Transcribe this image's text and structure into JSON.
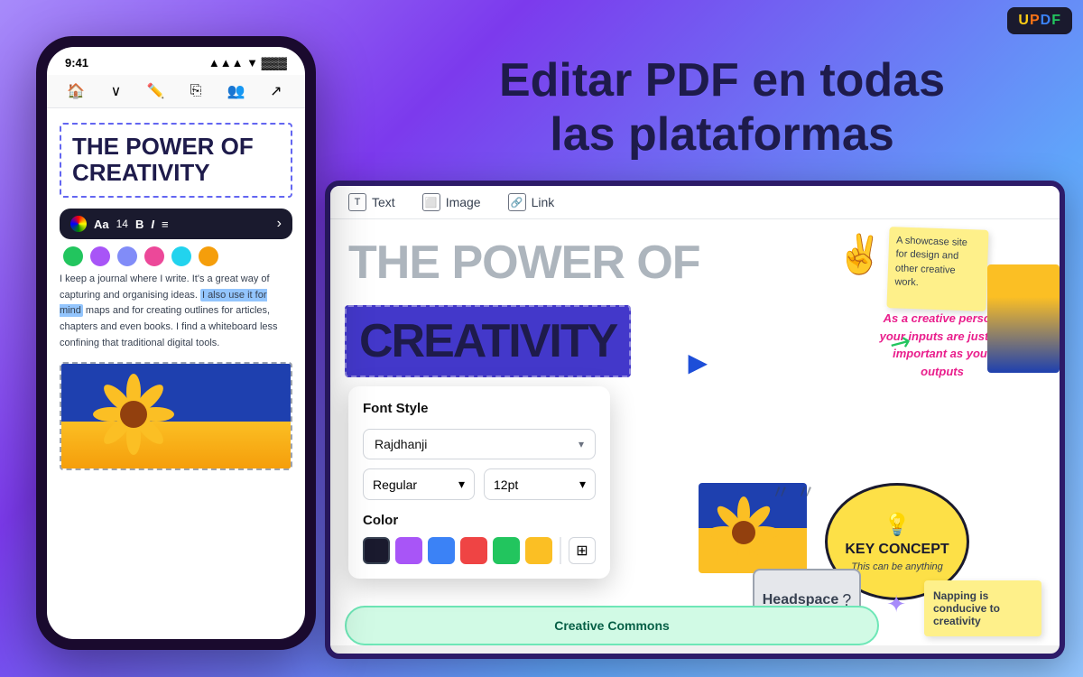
{
  "app": {
    "logo": "UPDF",
    "logo_colors": {
      "u": "#facc15",
      "p": "#f97316",
      "d": "#3b82f6",
      "f": "#22c55e"
    }
  },
  "hero": {
    "title_line1": "Editar PDF en todas",
    "title_line2": "las plataformas"
  },
  "phone": {
    "status_time": "9:41",
    "signal_icons": "▲▲▲ ▲ ▓▓▓",
    "title": "THE POWER OF CREATIVITY",
    "body_text": "I keep a journal where I write. It's a great way of capturing and organising ideas.",
    "highlight": "I also use it for mind",
    "body_text2": "maps and for creating outlines for articles, chapters and even books. I find a whiteboard less confining that traditional digital tools.",
    "text_toolbar": {
      "font_label": "Aa",
      "size": "14",
      "bold": "B",
      "italic": "I",
      "align": "≡"
    },
    "colors": [
      "#22c55e",
      "#a855f7",
      "#818cf8",
      "#ec4899",
      "#22d3ee",
      "#f59e0b"
    ]
  },
  "tablet": {
    "toolbar": {
      "items": [
        {
          "icon": "T",
          "label": "Text"
        },
        {
          "icon": "⬜",
          "label": "Image"
        },
        {
          "icon": "🔗",
          "label": "Link"
        }
      ]
    },
    "big_title_line1": "THE POWER OF",
    "big_title_line2": "CREATIVITY",
    "font_panel": {
      "title": "Font Style",
      "font_name": "Rajdhanji",
      "weight": "Regular",
      "size": "12pt",
      "color_section": "Color",
      "swatches": [
        "#1a1a2e",
        "#a855f7",
        "#3b82f6",
        "#ef4444",
        "#22c55e",
        "#fbbf24"
      ]
    }
  },
  "decorations": {
    "sticky_text": "A showcase site for design and other creative work.",
    "italic_text": "As a creative person, your inputs are just as important as your outputs",
    "key_concept_title": "KEY CONCEPT",
    "key_concept_sub": "This can be anything",
    "headspace_label": "Headspace",
    "napping_text": "Napping is conducive to creativity",
    "green_btn": "Creative Commons"
  }
}
